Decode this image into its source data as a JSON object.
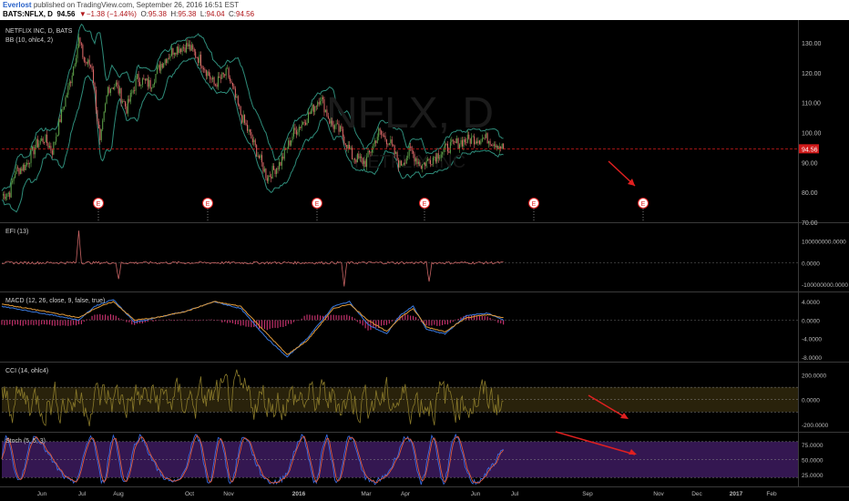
{
  "header": {
    "author": "Everlost",
    "published": "published on TradingView.com, September 26, 2016 16:51 EST",
    "symbol": "BATS:NFLX, D",
    "last": "94.56",
    "change": "▼−1.38 (−1.44%)",
    "o_label": "O:",
    "o": "95.38",
    "h_label": "H:",
    "h": "95.38",
    "l_label": "L:",
    "l": "94.04",
    "c_label": "C:",
    "c": "94.56"
  },
  "colors": {
    "background": "#000000",
    "panel_border": "#3a3a3a",
    "candle_up": "#5fa34a",
    "candle_down": "#e06a6a",
    "bollinger": "#2e8c7a",
    "price_line": "#d01a1a",
    "efi": "#c86464",
    "macd": "#3a7ae0",
    "macd_signal": "#e09a3a",
    "macd_hist": "#c0306a",
    "cci": "#8a7a2a",
    "cci_band": "#3a3010",
    "stoch_k": "#3a6ae0",
    "stoch_d": "#e05a3a",
    "stoch_band": "#3a1a5a",
    "arrow": "#e02020",
    "earnings": "#e02020"
  },
  "chart_data": [
    {
      "type": "candlestick",
      "pane": "price",
      "title": "NETFLIX INC, D, BATS",
      "indicator": "BB (10, ohlc4, 2)",
      "watermark": "NFLX, D",
      "watermark2": "NETFLIX INC",
      "ylim": [
        70,
        137
      ],
      "y_ticks": [
        "130.00",
        "120.00",
        "110.00",
        "100.00",
        "90.00",
        "80.00",
        "70.00"
      ],
      "last_price": 94.56,
      "last_price_label": "94.56",
      "earnings_markers": [
        "E",
        "E",
        "E",
        "E",
        "E",
        "E"
      ],
      "x_ticks": [
        "Jun",
        "Jul",
        "Aug",
        "Oct",
        "Nov",
        "2016",
        "Mar",
        "Apr",
        "Jun",
        "Jul",
        "Sep",
        "Nov",
        "Dec",
        "2017",
        "Feb"
      ],
      "trend_points": [
        [
          0,
          79
        ],
        [
          6,
          80
        ],
        [
          10,
          87
        ],
        [
          18,
          89
        ],
        [
          26,
          96
        ],
        [
          32,
          98
        ],
        [
          38,
          94
        ],
        [
          46,
          108
        ],
        [
          52,
          118
        ],
        [
          58,
          131
        ],
        [
          62,
          124
        ],
        [
          68,
          122
        ],
        [
          74,
          96
        ],
        [
          80,
          115
        ],
        [
          86,
          116
        ],
        [
          94,
          108
        ],
        [
          102,
          118
        ],
        [
          112,
          116
        ],
        [
          120,
          123
        ],
        [
          130,
          128
        ],
        [
          140,
          129
        ],
        [
          150,
          124
        ],
        [
          160,
          116
        ],
        [
          170,
          120
        ],
        [
          180,
          106
        ],
        [
          190,
          96
        ],
        [
          200,
          85
        ],
        [
          210,
          90
        ],
        [
          220,
          100
        ],
        [
          230,
          105
        ],
        [
          240,
          112
        ],
        [
          248,
          103
        ],
        [
          256,
          100
        ],
        [
          264,
          92
        ],
        [
          274,
          90
        ],
        [
          284,
          100
        ],
        [
          292,
          97
        ],
        [
          300,
          89
        ],
        [
          308,
          94
        ],
        [
          316,
          89
        ],
        [
          326,
          92
        ],
        [
          336,
          95
        ],
        [
          346,
          97
        ],
        [
          356,
          98
        ],
        [
          366,
          98
        ],
        [
          374,
          96
        ],
        [
          378,
          94.56
        ]
      ]
    },
    {
      "type": "line",
      "pane": "EFI",
      "title": "EFI (13)",
      "y_ticks": [
        "100000000.0000",
        "0.0000",
        "-100000000.0000"
      ],
      "ylim": [
        -120000000,
        170000000
      ],
      "spikes": [
        [
          58,
          150000000
        ],
        [
          88,
          -80000000
        ],
        [
          258,
          -110000000
        ],
        [
          322,
          -90000000
        ]
      ]
    },
    {
      "type": "line",
      "pane": "MACD",
      "title": "MACD (12, 26, close, 9, false, true)",
      "y_ticks": [
        "4.0000",
        "0.0000",
        "-4.0000",
        "-8.0000"
      ],
      "ylim": [
        -9,
        6
      ],
      "series": [
        {
          "points": [
            [
              0,
              3
            ],
            [
              20,
              2
            ],
            [
              40,
              1
            ],
            [
              58,
              0
            ],
            [
              70,
              3
            ],
            [
              84,
              4.5
            ],
            [
              100,
              -0.5
            ],
            [
              116,
              0.5
            ],
            [
              140,
              2
            ],
            [
              160,
              4
            ],
            [
              180,
              2.5
            ],
            [
              200,
              -4
            ],
            [
              215,
              -8
            ],
            [
              230,
              -4
            ],
            [
              250,
              3
            ],
            [
              262,
              4
            ],
            [
              276,
              -1
            ],
            [
              290,
              -3
            ],
            [
              300,
              1
            ],
            [
              310,
              3
            ],
            [
              320,
              -2
            ],
            [
              334,
              -3
            ],
            [
              350,
              1
            ],
            [
              366,
              1.5
            ],
            [
              378,
              0
            ]
          ]
        },
        {
          "points": [
            [
              0,
              3.5
            ],
            [
              20,
              2.5
            ],
            [
              40,
              1.5
            ],
            [
              58,
              0.5
            ],
            [
              70,
              2.5
            ],
            [
              84,
              4
            ],
            [
              100,
              0
            ],
            [
              116,
              0.5
            ],
            [
              140,
              2
            ],
            [
              160,
              4
            ],
            [
              180,
              3
            ],
            [
              200,
              -3
            ],
            [
              215,
              -7.5
            ],
            [
              230,
              -4.5
            ],
            [
              250,
              2.5
            ],
            [
              262,
              3.5
            ],
            [
              276,
              0
            ],
            [
              290,
              -2.5
            ],
            [
              300,
              0.5
            ],
            [
              310,
              2.5
            ],
            [
              320,
              -1.5
            ],
            [
              334,
              -2.5
            ],
            [
              350,
              0.5
            ],
            [
              366,
              1.2
            ],
            [
              378,
              0.5
            ]
          ]
        }
      ]
    },
    {
      "type": "line",
      "pane": "CCI",
      "title": "CCI (14, ohlc4)",
      "y_ticks": [
        "200.0000",
        "0.0000",
        "-200.0000"
      ],
      "ylim": [
        -260,
        300
      ],
      "upper_band": 100,
      "lower_band": -100
    },
    {
      "type": "line",
      "pane": "Stoch",
      "title": "Stoch (5, 5, 3)",
      "y_ticks": [
        "75.0000",
        "50.0000",
        "25.0000"
      ],
      "ylim": [
        5,
        95
      ],
      "upper_band": 80,
      "lower_band": 20
    }
  ]
}
